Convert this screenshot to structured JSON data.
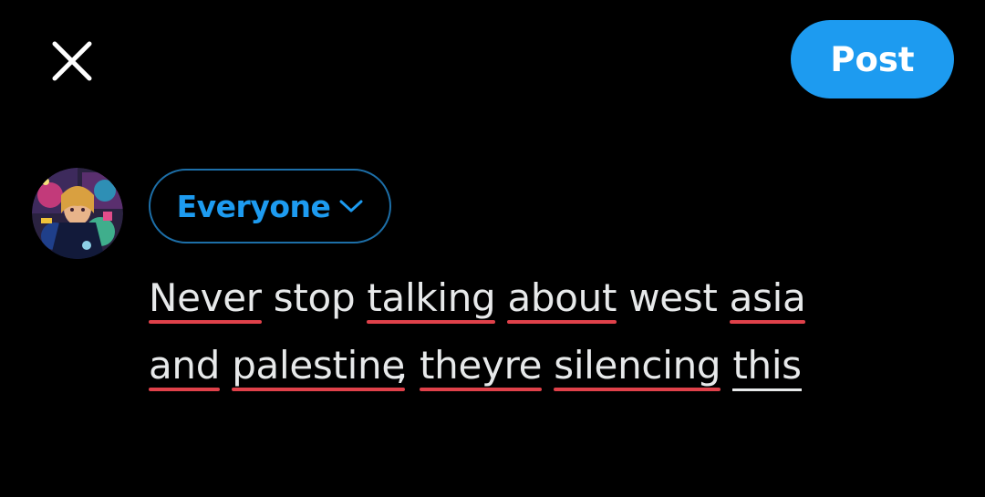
{
  "header": {
    "close_icon": "close-icon",
    "post_label": "Post"
  },
  "composer": {
    "avatar_icon": "user-avatar",
    "audience_label": "Everyone",
    "audience_icon": "chevron-down-icon",
    "line1": [
      {
        "text": "Never",
        "flag": "misspelled"
      },
      {
        "text": "stop",
        "flag": "none"
      },
      {
        "text": "talking",
        "flag": "misspelled"
      },
      {
        "text": "about",
        "flag": "misspelled"
      },
      {
        "text": "west",
        "flag": "none"
      },
      {
        "text": "asia",
        "flag": "misspelled"
      }
    ],
    "line2": [
      {
        "text": "and",
        "flag": "misspelled"
      },
      {
        "text": "palestine",
        "flag": "misspelled"
      },
      {
        "text": ",",
        "flag": "none"
      },
      {
        "text": "theyre",
        "flag": "misspelled"
      },
      {
        "text": "silencing",
        "flag": "misspelled"
      },
      {
        "text": "this",
        "flag": "current-word"
      }
    ]
  },
  "colors": {
    "accent": "#1d9bf0",
    "background": "#000000",
    "text": "#e7e9ea",
    "spellcheck": "#e0414a"
  }
}
